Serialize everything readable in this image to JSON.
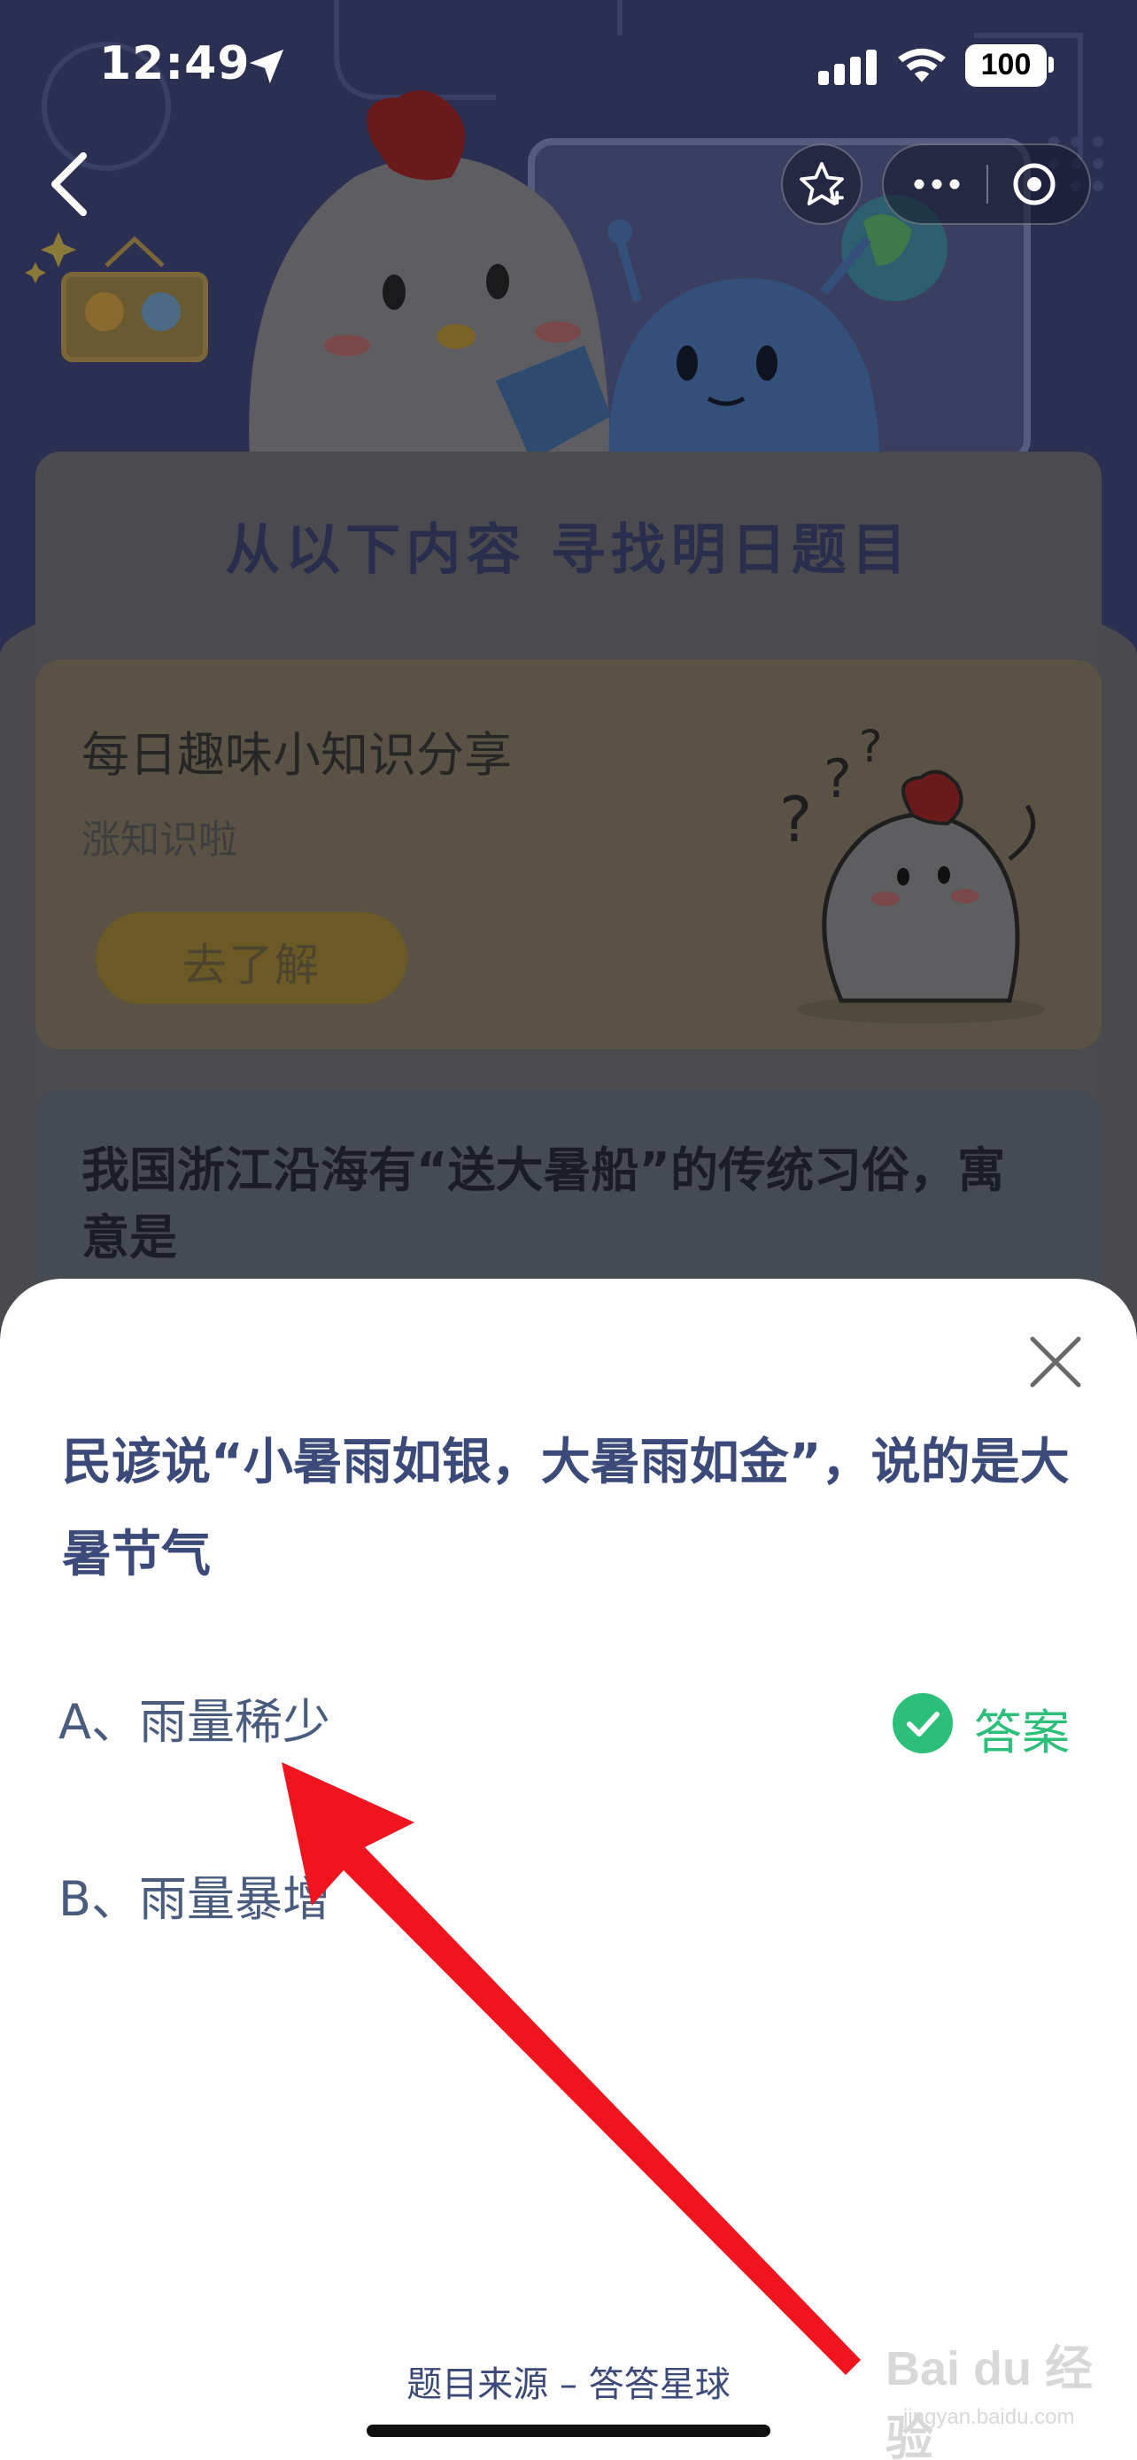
{
  "status_bar": {
    "time": "12:49",
    "battery": "100",
    "icons": [
      "location-arrow-icon",
      "signal-icon",
      "wifi-icon",
      "battery-icon"
    ]
  },
  "nav": {
    "icons": [
      "back-chevron-icon",
      "star-icon",
      "more-dots-icon",
      "target-close-icon"
    ]
  },
  "background_page": {
    "banner_title": "从以下内容 寻找明日题目",
    "fact_card": {
      "title": "每日趣味小知识分享",
      "subtitle": "涨知识啦",
      "button_label": "去了解"
    },
    "question_card": {
      "text": "我国浙江沿海有“送大暑船”的传统习俗，寓意是"
    }
  },
  "sheet": {
    "question": "民谚说“小暑雨如银，大暑雨如金”，说的是大暑节气",
    "options": [
      {
        "label": "A、雨量稀少"
      },
      {
        "label": "B、雨量暴增"
      }
    ],
    "answer_label": "答案",
    "footer": "题目来源 – 答答星球"
  },
  "watermark": {
    "text": "Bai du 经验",
    "url": "jingyan.baidu.com"
  },
  "colors": {
    "question_text": "#3c4a7a",
    "option_text": "#4a5c7d",
    "answer_green": "#2bbf7a",
    "arrow_red": "#f0141e"
  }
}
